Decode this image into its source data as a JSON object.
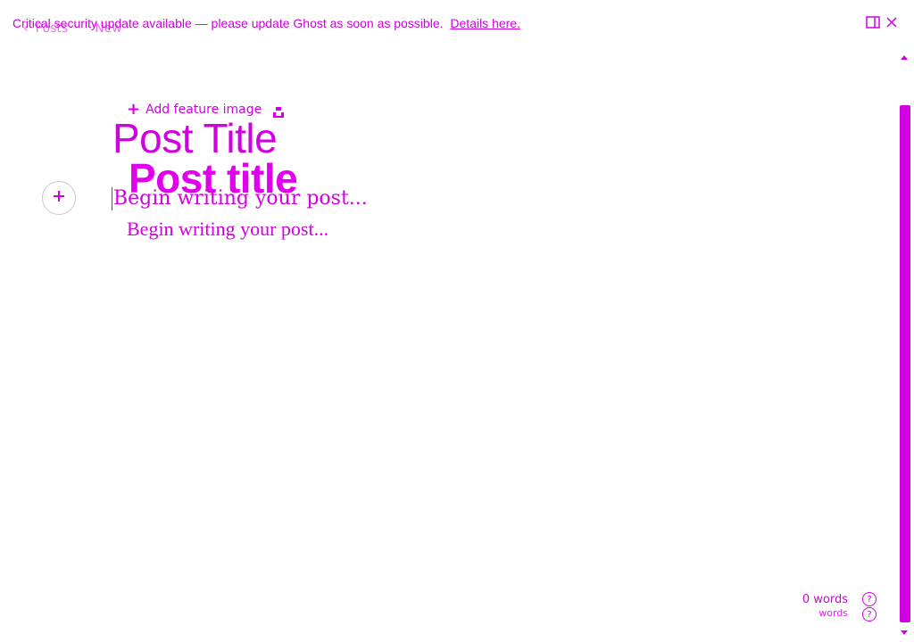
{
  "breadcrumb": {
    "back_glyph": "‹",
    "posts_label": "Posts",
    "status_label": "New"
  },
  "banner": {
    "message": "Critical security update available — please update Ghost as soon as possible.",
    "link_label": "Details here."
  },
  "editor": {
    "feature_image_label": "Add feature image",
    "title_placeholder": "Post Title",
    "title_value": "Post title",
    "body_placeholder_primary": "Begin writing your post...",
    "body_placeholder_secondary": "Begin writing your post..."
  },
  "footer": {
    "word_count": "0 words",
    "word_count_small": "words",
    "help_glyph": "?"
  },
  "colors": {
    "accent": "#d000e0",
    "border": "#c9c9c9"
  },
  "icons": [
    "chevron-left-icon",
    "sidebar-toggle-icon",
    "close-icon",
    "plus-icon",
    "unsplash-icon",
    "help-icon"
  ]
}
